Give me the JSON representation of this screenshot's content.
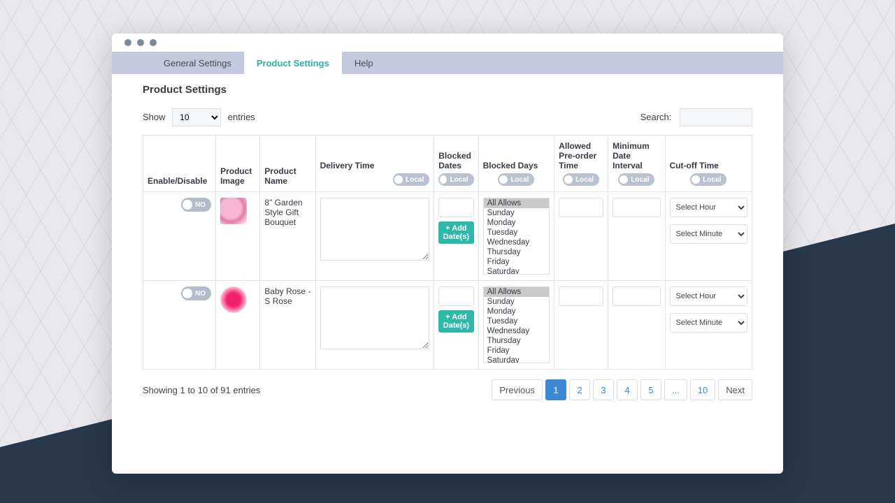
{
  "tabs": {
    "general": "General Settings",
    "product": "Product Settings",
    "help": "Help"
  },
  "page_title": "Product Settings",
  "show": {
    "label_before": "Show",
    "label_after": "entries",
    "value": "10"
  },
  "search": {
    "label": "Search:",
    "value": ""
  },
  "columns": {
    "enable": "Enable/Disable",
    "image": "Product Image",
    "name": "Product Name",
    "delivery": "Delivery Time",
    "blocked_dates": "Blocked Dates",
    "blocked_days": "Blocked Days",
    "preorder": "Allowed Pre-order Time",
    "min_interval": "Minimum Date Interval",
    "cutoff": "Cut-off Time",
    "local_badge": "Local"
  },
  "add_dates_label": "+ Add Date(s)",
  "day_options": [
    "All Allows",
    "Sunday",
    "Monday",
    "Tuesday",
    "Wednesday",
    "Thursday",
    "Friday",
    "Saturday"
  ],
  "cutoff_selects": {
    "hour": "Select Hour",
    "minute": "Select Minute"
  },
  "rows": [
    {
      "enabled_label": "NO",
      "name": "8\" Garden Style Gift Bouquet",
      "thumb": "pink"
    },
    {
      "enabled_label": "NO",
      "name": "Baby Rose - S Rose",
      "thumb": "rose"
    }
  ],
  "footer_info": "Showing 1 to 10 of 91 entries",
  "pagination": {
    "prev": "Previous",
    "next": "Next",
    "pages": [
      "1",
      "2",
      "3",
      "4",
      "5",
      "...",
      "10"
    ],
    "current": "1"
  }
}
